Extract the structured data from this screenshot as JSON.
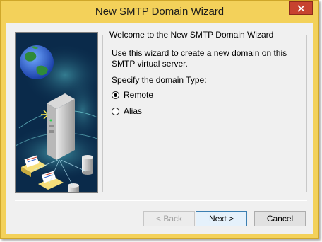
{
  "window": {
    "title": "New SMTP Domain Wizard"
  },
  "group": {
    "caption": "Welcome to the New SMTP Domain Wizard",
    "description": "Use this wizard to create a new domain on this SMTP virtual server.",
    "specify_label": "Specify the domain Type:"
  },
  "options": [
    {
      "label": "Remote",
      "selected": true
    },
    {
      "label": "Alias",
      "selected": false
    }
  ],
  "buttons": {
    "back": "< Back",
    "next": "Next >",
    "cancel": "Cancel"
  },
  "icons": {
    "close": "close-icon",
    "illustration": "smtp-server-globe-illustration"
  },
  "colors": {
    "frame": "#f3d15a",
    "close": "#c7432f",
    "art_background": "#0a2a4a"
  }
}
